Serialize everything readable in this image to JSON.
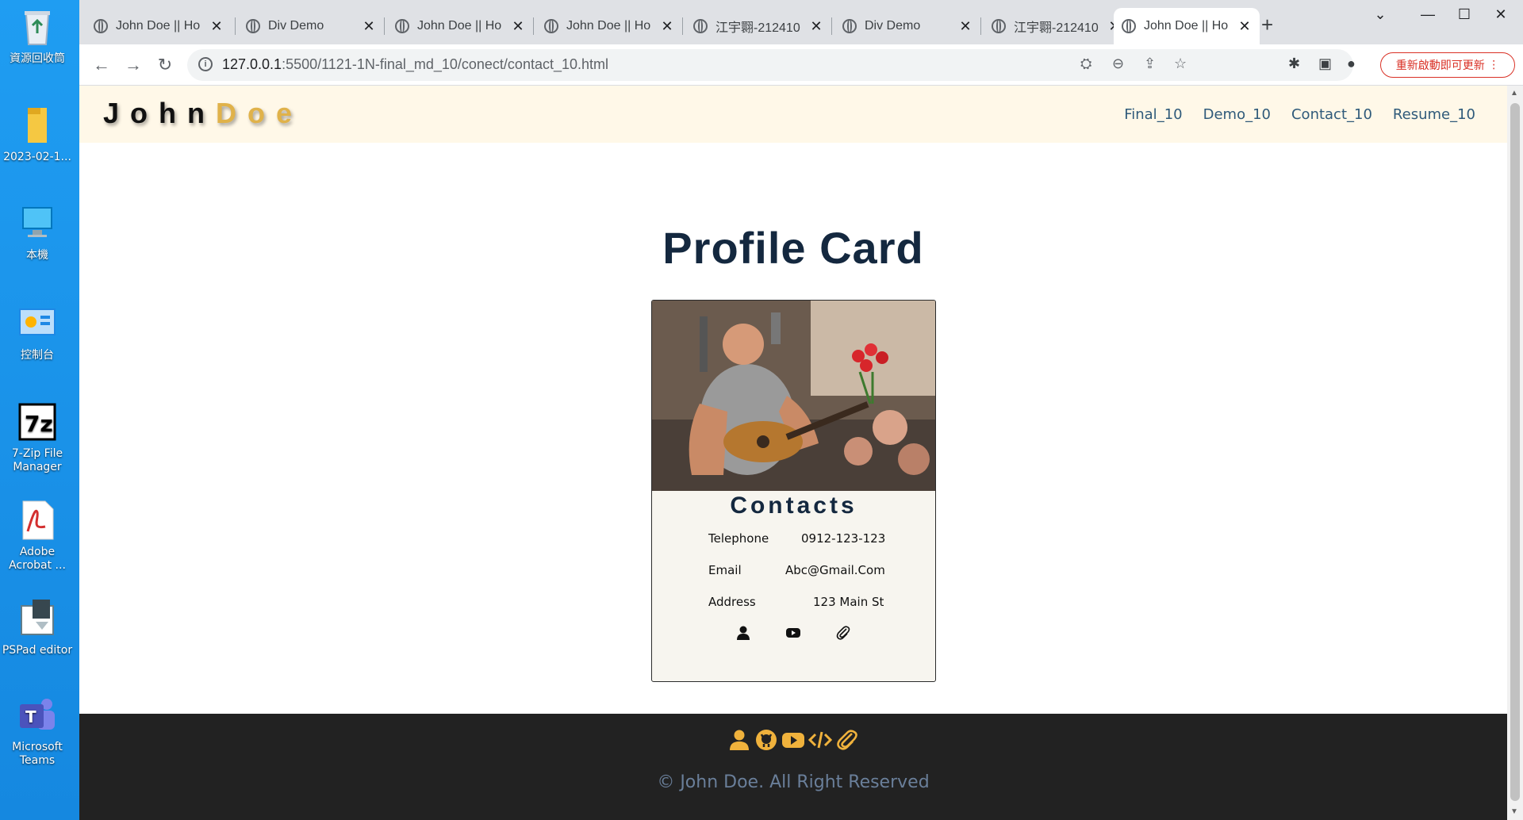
{
  "desktop": {
    "icons": [
      {
        "label": "資源回收筒",
        "icon": "recycle-bin-icon"
      },
      {
        "label": "2023-02-1...",
        "icon": "folder-icon"
      },
      {
        "label": "本機",
        "icon": "computer-icon"
      },
      {
        "label": "控制台",
        "icon": "control-panel-icon"
      },
      {
        "label": "7-Zip File Manager",
        "icon": "7zip-icon"
      },
      {
        "label": "Adobe Acrobat ...",
        "icon": "acrobat-icon"
      },
      {
        "label": "PSPad editor",
        "icon": "pspad-icon"
      },
      {
        "label": "Microsoft Teams",
        "icon": "teams-icon"
      }
    ]
  },
  "browser": {
    "tabs": [
      {
        "title": "John Doe || Ho",
        "active": false
      },
      {
        "title": "Div Demo",
        "active": false
      },
      {
        "title": "John Doe || Ho",
        "active": false
      },
      {
        "title": "John Doe || Ho",
        "active": false
      },
      {
        "title": "江宇翾-212410",
        "active": false
      },
      {
        "title": "Div Demo",
        "active": false
      },
      {
        "title": "江宇翾-212410",
        "active": false
      },
      {
        "title": "John Doe || Ho",
        "active": true
      }
    ],
    "url_host": "127.0.0.1",
    "url_path": ":5500/1121-1N-final_md_10/conect/contact_10.html",
    "update_button": "重新啟動即可更新"
  },
  "site": {
    "logo_main": "John",
    "logo_accent": "Doe",
    "nav": [
      "Final_10",
      "Demo_10",
      "Contact_10",
      "Resume_10"
    ],
    "page_title": "Profile Card",
    "card": {
      "contacts_title": "Contacts",
      "rows": [
        {
          "label": "Telephone",
          "value": "0912-123-123"
        },
        {
          "label": "Email",
          "value": "Abc@Gmail.Com"
        },
        {
          "label": "Address",
          "value": "123 Main St"
        }
      ],
      "icons": [
        "user-icon",
        "youtube-icon",
        "paperclip-icon"
      ]
    },
    "footer": {
      "icons": [
        "user-icon",
        "github-icon",
        "youtube-icon",
        "code-icon",
        "paperclip-icon"
      ],
      "icon_color": "#f0b23c",
      "copyright": "© John Doe. All Right Reserved"
    }
  }
}
